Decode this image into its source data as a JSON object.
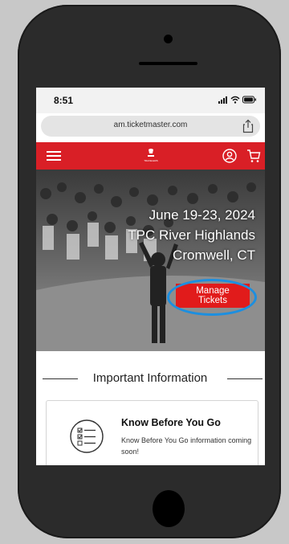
{
  "status_bar": {
    "time": "8:51"
  },
  "browser": {
    "url": "am.ticketmaster.com"
  },
  "nav": {
    "logo_label": "TRAVELERS"
  },
  "hero": {
    "line1": "June 19-23, 2024",
    "line2": "TPC River Highlands",
    "line3": "Cromwell, CT",
    "button_label": "Manage Tickets"
  },
  "section": {
    "heading": "Important Information"
  },
  "card": {
    "title": "Know Before You Go",
    "body": "Know Before You Go information coming soon!"
  },
  "colors": {
    "brand_red": "#d91f26",
    "button_red": "#e11b1b",
    "highlight_blue": "#1c8fe0"
  },
  "icons": [
    "menu-icon",
    "account-icon",
    "cart-icon",
    "share-icon",
    "checklist-icon",
    "signal-icon",
    "wifi-icon",
    "battery-icon"
  ]
}
